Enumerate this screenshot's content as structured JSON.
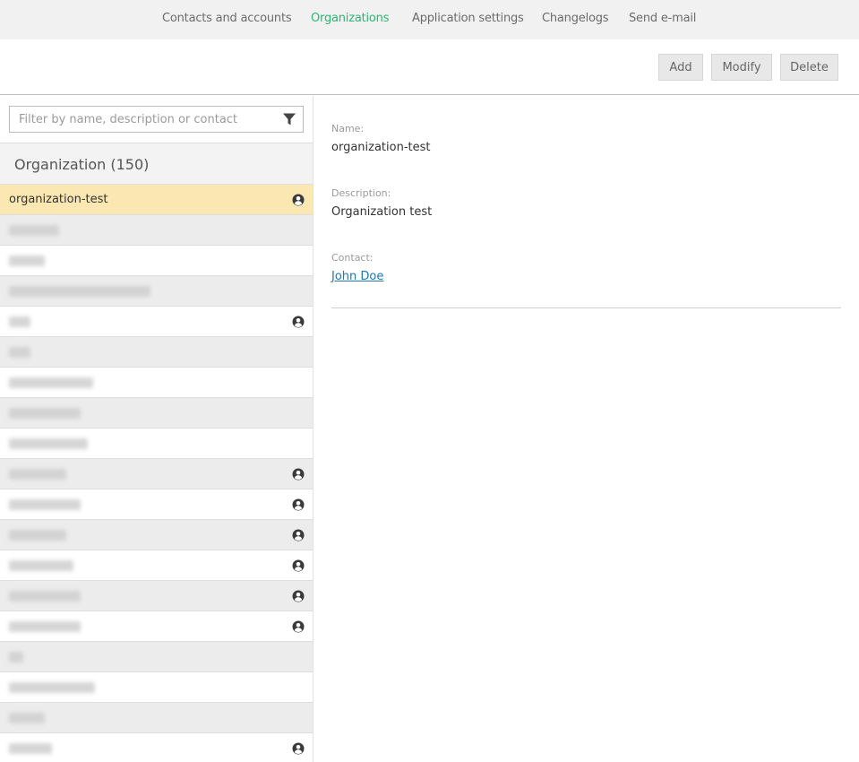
{
  "nav": {
    "items": [
      {
        "label": "Contacts and accounts",
        "active": false
      },
      {
        "label": "Organizations",
        "active": true
      },
      {
        "label": "Application settings",
        "active": false
      },
      {
        "label": "Changelogs",
        "active": false
      },
      {
        "label": "Send e-mail",
        "active": false
      }
    ],
    "active_color": "#2bb673"
  },
  "toolbar": {
    "add_label": "Add",
    "modify_label": "Modify",
    "delete_label": "Delete"
  },
  "filter": {
    "placeholder": "Filter by name, description or contact",
    "value": "",
    "icon": "filter-icon"
  },
  "list": {
    "title": "Organization (150)",
    "selected_color": "#fbe7b2",
    "rows": [
      {
        "label": "organization-test",
        "blurred": false,
        "has_contact": true
      },
      {
        "label": "",
        "blurred": true,
        "has_contact": false
      },
      {
        "label": "",
        "blurred": true,
        "has_contact": false
      },
      {
        "label": "",
        "blurred": true,
        "has_contact": false
      },
      {
        "label": "",
        "blurred": true,
        "has_contact": true
      },
      {
        "label": "",
        "blurred": true,
        "has_contact": false
      },
      {
        "label": "",
        "blurred": true,
        "has_contact": false
      },
      {
        "label": "",
        "blurred": true,
        "has_contact": false
      },
      {
        "label": "",
        "blurred": true,
        "has_contact": false
      },
      {
        "label": "",
        "blurred": true,
        "has_contact": true
      },
      {
        "label": "",
        "blurred": true,
        "has_contact": true
      },
      {
        "label": "",
        "blurred": true,
        "has_contact": true
      },
      {
        "label": "",
        "blurred": true,
        "has_contact": true
      },
      {
        "label": "",
        "blurred": true,
        "has_contact": true
      },
      {
        "label": "",
        "blurred": true,
        "has_contact": true
      },
      {
        "label": "",
        "blurred": true,
        "has_contact": false
      },
      {
        "label": "",
        "blurred": true,
        "has_contact": false
      },
      {
        "label": "",
        "blurred": true,
        "has_contact": false
      },
      {
        "label": "",
        "blurred": true,
        "has_contact": true
      }
    ]
  },
  "detail": {
    "name_label": "Name:",
    "name_value": "organization-test",
    "description_label": "Description:",
    "description_value": "Organization test",
    "contact_label": "Contact:",
    "contact_value": "John Doe"
  }
}
